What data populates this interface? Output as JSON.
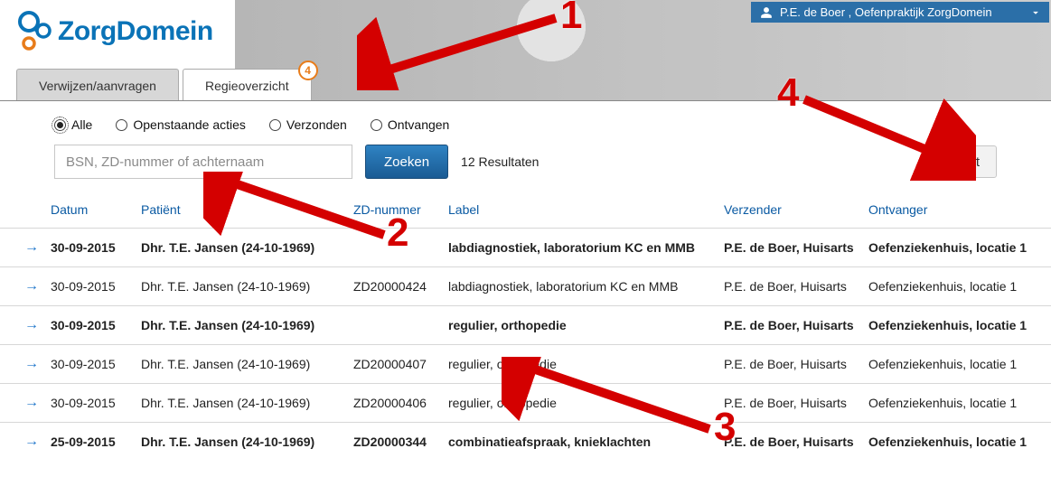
{
  "user": {
    "name": "P.E. de Boer ,  Oefenpraktijk ZorgDomein"
  },
  "logo_text": "ZorgDomein",
  "tabs": [
    {
      "label": "Verwijzen/aanvragen",
      "active": false
    },
    {
      "label": "Regieoverzicht",
      "active": true,
      "badge": "4"
    }
  ],
  "filters": [
    {
      "label": "Alle",
      "selected": true
    },
    {
      "label": "Openstaande acties",
      "selected": false
    },
    {
      "label": "Verzonden",
      "selected": false
    },
    {
      "label": "Ontvangen",
      "selected": false
    }
  ],
  "search": {
    "placeholder": "BSN, ZD-nummer of achternaam",
    "button": "Zoeken",
    "results": "12 Resultaten"
  },
  "export_label": "Export",
  "columns": {
    "date": "Datum",
    "patient": "Patiënt",
    "zd": "ZD-nummer",
    "label": "Label",
    "sender": "Verzender",
    "receiver": "Ontvanger"
  },
  "rows": [
    {
      "bold": true,
      "date": "30-09-2015",
      "patient": "Dhr. T.E. Jansen (24-10-1969)",
      "zd": "",
      "label": "labdiagnostiek, laboratorium KC en MMB",
      "sender": "P.E. de Boer, Huisarts",
      "receiver": "Oefenziekenhuis, locatie 1"
    },
    {
      "bold": false,
      "date": "30-09-2015",
      "patient": "Dhr. T.E. Jansen (24-10-1969)",
      "zd": "ZD20000424",
      "label": "labdiagnostiek, laboratorium KC en MMB",
      "sender": "P.E. de Boer, Huisarts",
      "receiver": "Oefenziekenhuis, locatie 1"
    },
    {
      "bold": true,
      "date": "30-09-2015",
      "patient": "Dhr. T.E. Jansen (24-10-1969)",
      "zd": "",
      "label": "regulier, orthopedie",
      "sender": "P.E. de Boer, Huisarts",
      "receiver": "Oefenziekenhuis, locatie 1"
    },
    {
      "bold": false,
      "date": "30-09-2015",
      "patient": "Dhr. T.E. Jansen (24-10-1969)",
      "zd": "ZD20000407",
      "label": "regulier, orthopedie",
      "sender": "P.E. de Boer, Huisarts",
      "receiver": "Oefenziekenhuis, locatie 1"
    },
    {
      "bold": false,
      "date": "30-09-2015",
      "patient": "Dhr. T.E. Jansen (24-10-1969)",
      "zd": "ZD20000406",
      "label": "regulier, orthopedie",
      "sender": "P.E. de Boer, Huisarts",
      "receiver": "Oefenziekenhuis, locatie 1"
    },
    {
      "bold": true,
      "date": "25-09-2015",
      "patient": "Dhr. T.E. Jansen (24-10-1969)",
      "zd": "ZD20000344",
      "label": "combinatieafspraak, knieklachten",
      "sender": "P.E. de Boer, Huisarts",
      "receiver": "Oefenziekenhuis, locatie 1"
    }
  ],
  "annotations": {
    "n1": "1",
    "n2": "2",
    "n3": "3",
    "n4": "4"
  }
}
